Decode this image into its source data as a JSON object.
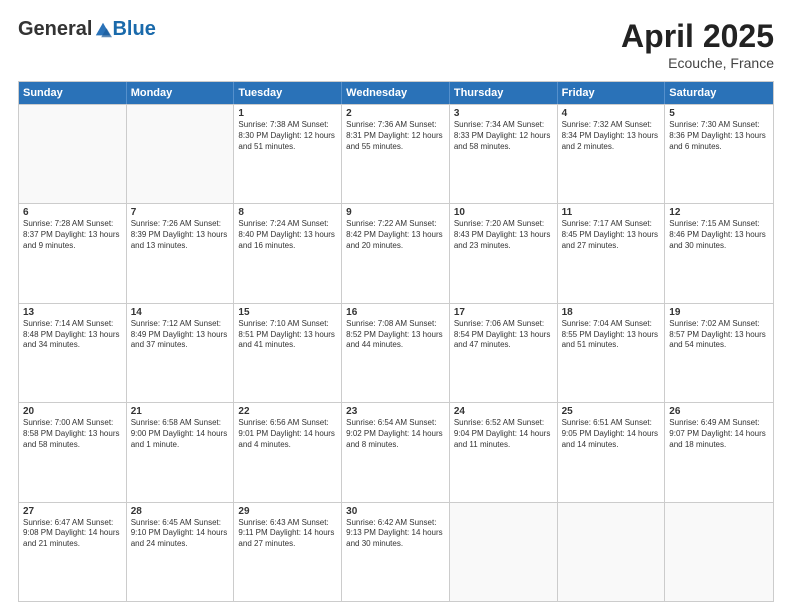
{
  "header": {
    "logo_general": "General",
    "logo_blue": "Blue",
    "title": "April 2025",
    "location": "Ecouche, France"
  },
  "days_header": [
    "Sunday",
    "Monday",
    "Tuesday",
    "Wednesday",
    "Thursday",
    "Friday",
    "Saturday"
  ],
  "weeks": [
    [
      {
        "day": "",
        "info": "",
        "empty": true
      },
      {
        "day": "",
        "info": "",
        "empty": true
      },
      {
        "day": "1",
        "info": "Sunrise: 7:38 AM\nSunset: 8:30 PM\nDaylight: 12 hours and 51 minutes.",
        "empty": false
      },
      {
        "day": "2",
        "info": "Sunrise: 7:36 AM\nSunset: 8:31 PM\nDaylight: 12 hours and 55 minutes.",
        "empty": false
      },
      {
        "day": "3",
        "info": "Sunrise: 7:34 AM\nSunset: 8:33 PM\nDaylight: 12 hours and 58 minutes.",
        "empty": false
      },
      {
        "day": "4",
        "info": "Sunrise: 7:32 AM\nSunset: 8:34 PM\nDaylight: 13 hours and 2 minutes.",
        "empty": false
      },
      {
        "day": "5",
        "info": "Sunrise: 7:30 AM\nSunset: 8:36 PM\nDaylight: 13 hours and 6 minutes.",
        "empty": false
      }
    ],
    [
      {
        "day": "6",
        "info": "Sunrise: 7:28 AM\nSunset: 8:37 PM\nDaylight: 13 hours and 9 minutes.",
        "empty": false
      },
      {
        "day": "7",
        "info": "Sunrise: 7:26 AM\nSunset: 8:39 PM\nDaylight: 13 hours and 13 minutes.",
        "empty": false
      },
      {
        "day": "8",
        "info": "Sunrise: 7:24 AM\nSunset: 8:40 PM\nDaylight: 13 hours and 16 minutes.",
        "empty": false
      },
      {
        "day": "9",
        "info": "Sunrise: 7:22 AM\nSunset: 8:42 PM\nDaylight: 13 hours and 20 minutes.",
        "empty": false
      },
      {
        "day": "10",
        "info": "Sunrise: 7:20 AM\nSunset: 8:43 PM\nDaylight: 13 hours and 23 minutes.",
        "empty": false
      },
      {
        "day": "11",
        "info": "Sunrise: 7:17 AM\nSunset: 8:45 PM\nDaylight: 13 hours and 27 minutes.",
        "empty": false
      },
      {
        "day": "12",
        "info": "Sunrise: 7:15 AM\nSunset: 8:46 PM\nDaylight: 13 hours and 30 minutes.",
        "empty": false
      }
    ],
    [
      {
        "day": "13",
        "info": "Sunrise: 7:14 AM\nSunset: 8:48 PM\nDaylight: 13 hours and 34 minutes.",
        "empty": false
      },
      {
        "day": "14",
        "info": "Sunrise: 7:12 AM\nSunset: 8:49 PM\nDaylight: 13 hours and 37 minutes.",
        "empty": false
      },
      {
        "day": "15",
        "info": "Sunrise: 7:10 AM\nSunset: 8:51 PM\nDaylight: 13 hours and 41 minutes.",
        "empty": false
      },
      {
        "day": "16",
        "info": "Sunrise: 7:08 AM\nSunset: 8:52 PM\nDaylight: 13 hours and 44 minutes.",
        "empty": false
      },
      {
        "day": "17",
        "info": "Sunrise: 7:06 AM\nSunset: 8:54 PM\nDaylight: 13 hours and 47 minutes.",
        "empty": false
      },
      {
        "day": "18",
        "info": "Sunrise: 7:04 AM\nSunset: 8:55 PM\nDaylight: 13 hours and 51 minutes.",
        "empty": false
      },
      {
        "day": "19",
        "info": "Sunrise: 7:02 AM\nSunset: 8:57 PM\nDaylight: 13 hours and 54 minutes.",
        "empty": false
      }
    ],
    [
      {
        "day": "20",
        "info": "Sunrise: 7:00 AM\nSunset: 8:58 PM\nDaylight: 13 hours and 58 minutes.",
        "empty": false
      },
      {
        "day": "21",
        "info": "Sunrise: 6:58 AM\nSunset: 9:00 PM\nDaylight: 14 hours and 1 minute.",
        "empty": false
      },
      {
        "day": "22",
        "info": "Sunrise: 6:56 AM\nSunset: 9:01 PM\nDaylight: 14 hours and 4 minutes.",
        "empty": false
      },
      {
        "day": "23",
        "info": "Sunrise: 6:54 AM\nSunset: 9:02 PM\nDaylight: 14 hours and 8 minutes.",
        "empty": false
      },
      {
        "day": "24",
        "info": "Sunrise: 6:52 AM\nSunset: 9:04 PM\nDaylight: 14 hours and 11 minutes.",
        "empty": false
      },
      {
        "day": "25",
        "info": "Sunrise: 6:51 AM\nSunset: 9:05 PM\nDaylight: 14 hours and 14 minutes.",
        "empty": false
      },
      {
        "day": "26",
        "info": "Sunrise: 6:49 AM\nSunset: 9:07 PM\nDaylight: 14 hours and 18 minutes.",
        "empty": false
      }
    ],
    [
      {
        "day": "27",
        "info": "Sunrise: 6:47 AM\nSunset: 9:08 PM\nDaylight: 14 hours and 21 minutes.",
        "empty": false
      },
      {
        "day": "28",
        "info": "Sunrise: 6:45 AM\nSunset: 9:10 PM\nDaylight: 14 hours and 24 minutes.",
        "empty": false
      },
      {
        "day": "29",
        "info": "Sunrise: 6:43 AM\nSunset: 9:11 PM\nDaylight: 14 hours and 27 minutes.",
        "empty": false
      },
      {
        "day": "30",
        "info": "Sunrise: 6:42 AM\nSunset: 9:13 PM\nDaylight: 14 hours and 30 minutes.",
        "empty": false
      },
      {
        "day": "",
        "info": "",
        "empty": true
      },
      {
        "day": "",
        "info": "",
        "empty": true
      },
      {
        "day": "",
        "info": "",
        "empty": true
      }
    ]
  ]
}
